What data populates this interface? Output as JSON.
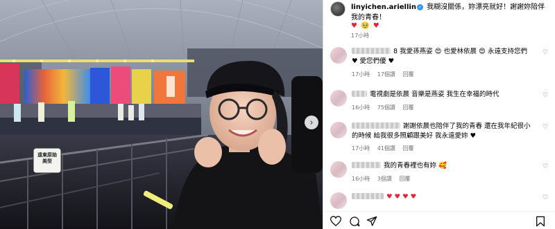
{
  "post": {
    "username": "linyichen.ariellin",
    "caption_text": "我糊沒關係，妳漂亮就好！謝謝妳陪伴我的青春！",
    "caption_emojis": "♥ 🥹 ♥",
    "time": "17小時"
  },
  "comments": [
    {
      "text": "8 我愛孫燕姿 😍 也愛林依晨 😍 永遠支持您們 ♥ 愛您們優 ♥",
      "time": "17小時",
      "likes": "17個讚",
      "reply": "回覆"
    },
    {
      "text": "電視劇是依晨 音樂是燕姿 我生在幸福的時代",
      "time": "16小時",
      "likes": "75個讚",
      "reply": "回覆"
    },
    {
      "text": "謝謝依晨也陪伴了我的青春 還在我年紀很小的時候 給我很多照顧跟美好 我永遠愛妳 ♥",
      "time": "17小時",
      "likes": "41個讚",
      "reply": "回覆"
    },
    {
      "text": "我的青春裡也有妳 🥰",
      "time": "16小時",
      "likes": "3個讚",
      "reply": "回覆"
    },
    {
      "text": "♥ ♥ ♥ ♥",
      "time": "",
      "likes": "",
      "reply": ""
    }
  ],
  "photo": {
    "sign_text": "遠東原始美型"
  },
  "icons": {
    "next": "chevron-right-icon",
    "like": "heart-icon",
    "comment": "comment-icon",
    "share": "share-icon",
    "save": "bookmark-icon"
  },
  "colors": {
    "heart": "#e2263a",
    "verified": "#3897f0",
    "meta_text": "#737373"
  }
}
